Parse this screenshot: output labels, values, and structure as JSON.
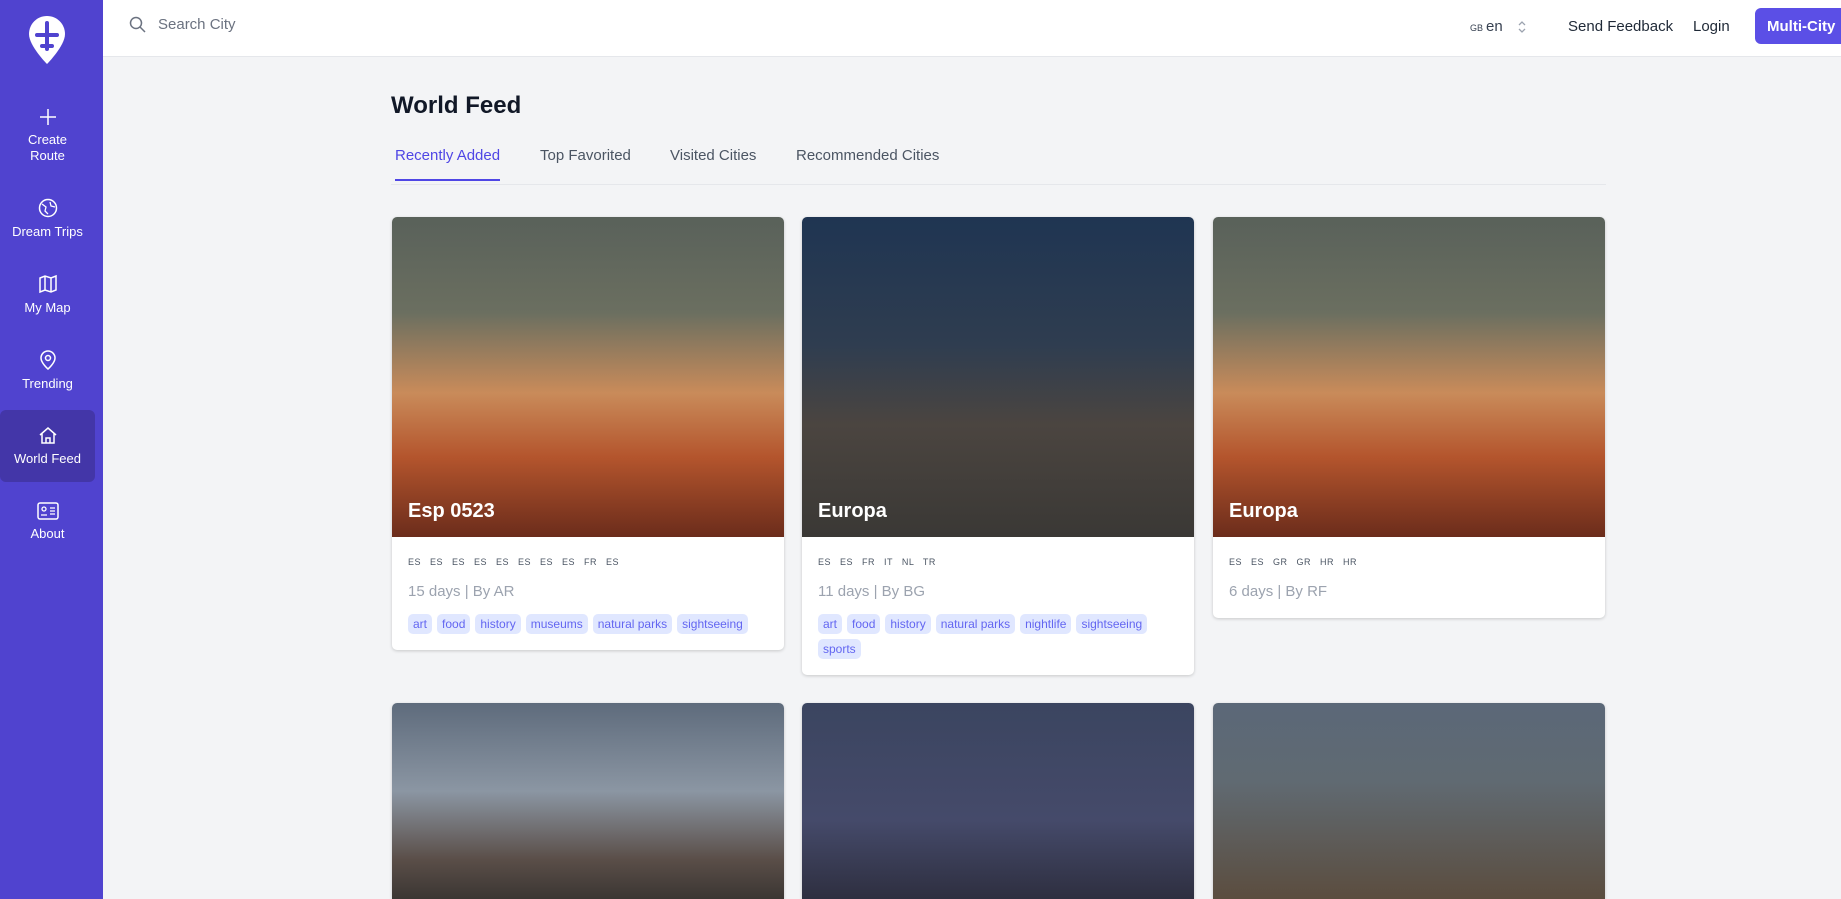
{
  "sidebar": {
    "items": [
      {
        "label": "Create Route",
        "icon": "plus-icon"
      },
      {
        "label": "Dream Trips",
        "icon": "globe-icon"
      },
      {
        "label": "My Map",
        "icon": "map-icon"
      },
      {
        "label": "Trending",
        "icon": "map-pin-icon"
      },
      {
        "label": "World Feed",
        "icon": "home-icon",
        "active": true
      },
      {
        "label": "About",
        "icon": "id-card-icon"
      }
    ]
  },
  "header": {
    "search_placeholder": "Search City",
    "lang_flag": "GB",
    "lang": "en",
    "feedback": "Send Feedback",
    "login": "Login",
    "multi_city": "Multi-City"
  },
  "page": {
    "title": "World Feed",
    "tabs": [
      "Recently Added",
      "Top Favorited",
      "Visited Cities",
      "Recommended Cities"
    ]
  },
  "cards": [
    {
      "title": "Esp 0523",
      "flags": "ES ES ES ES ES ES ES ES FR ES",
      "meta": "15 days | By AR",
      "tags": [
        "art",
        "food",
        "history",
        "museums",
        "natural parks",
        "sightseeing"
      ]
    },
    {
      "title": "Europa",
      "flags": "ES ES FR IT NL TR",
      "meta": "11 days | By BG",
      "tags": [
        "art",
        "food",
        "history",
        "natural parks",
        "nightlife",
        "sightseeing",
        "sports"
      ]
    },
    {
      "title": "Europa",
      "flags": "ES ES GR GR HR HR",
      "meta": "6 days | By RF",
      "tags": []
    }
  ],
  "accent": "#4f46e5"
}
